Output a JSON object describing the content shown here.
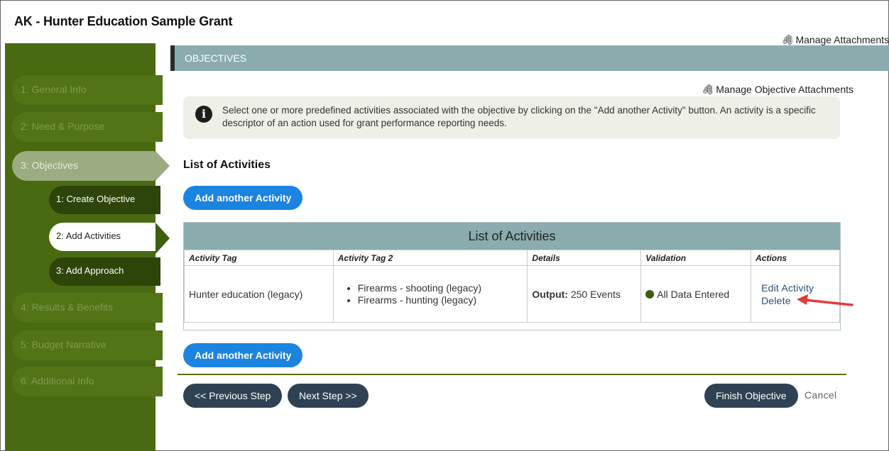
{
  "app": {
    "title": "AK - Hunter Education Sample Grant",
    "manage_attachments": "Manage Attachments"
  },
  "sidebar": {
    "items": [
      {
        "label": "1: General Info"
      },
      {
        "label": "2: Need & Purpose"
      },
      {
        "label": "3: Objectives"
      },
      {
        "label": "4: Results & Benefits"
      },
      {
        "label": "5: Budget Narrative"
      },
      {
        "label": "6: Additional Info"
      }
    ],
    "sub_items": [
      {
        "label": "1: Create Objective"
      },
      {
        "label": "2: Add Activities"
      },
      {
        "label": "3: Add Approach"
      }
    ],
    "active_index": 2,
    "current_sub_index": 1
  },
  "section": {
    "title": "OBJECTIVES",
    "manage_objective_attachments": "Manage Objective Attachments",
    "info_text": "Select one or more predefined activities associated with the objective by clicking on the \"Add another Activity\" button. An activity is a specific descriptor of an action used for grant performance reporting needs."
  },
  "activities": {
    "list_title": "List of Activities",
    "add_button_label": "Add another Activity",
    "table_caption": "List of Activities",
    "columns": [
      "Activity Tag",
      "Activity Tag 2",
      "Details",
      "Validation",
      "Actions"
    ],
    "rows": [
      {
        "activity_tag": "Hunter education (legacy)",
        "activity_tag_2": [
          "Firearms - shooting (legacy)",
          "Firearms - hunting (legacy)"
        ],
        "details_label": "Output:",
        "details_value": "250 Events",
        "validation": "All Data Entered",
        "action_edit": "Edit Activity",
        "action_delete": "Delete"
      }
    ]
  },
  "footer": {
    "previous_label": "<< Previous Step",
    "next_label": "Next Step >>",
    "finish_label": "Finish Objective",
    "cancel_label": "Cancel"
  },
  "colors": {
    "sidebar_bg": "#4a6a12",
    "section_bar": "#8aacaf",
    "primary_button": "#1b84e0",
    "dark_button": "#2f4254",
    "validation_dot": "#3b5e12",
    "annotation_arrow": "#e23b3b"
  },
  "icons": {
    "attachment": "paperclip-icon",
    "info": "info-circle-icon",
    "status": "status-dot-icon",
    "annotation": "red-arrow-icon"
  }
}
